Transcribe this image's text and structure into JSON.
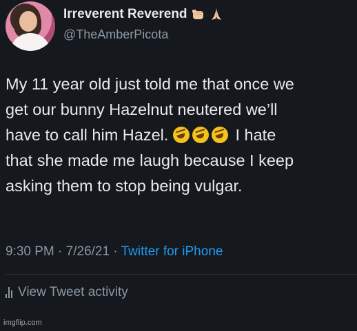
{
  "author": {
    "display_name": "Irreverent Reverend",
    "handle": "@TheAmberPicota",
    "name_emojis": [
      "fist-bump-emoji",
      "praying-hands-emoji"
    ]
  },
  "tweet": {
    "lines": [
      "My 11 year old just told me that once we",
      "get our bunny Hazelnut neutered we’ll",
      "have to call him Hazel.",
      "that she made me laugh because I keep",
      "asking them to stop being vulgar."
    ],
    "line3_after_emoji": "I hate",
    "emoji_count": 3
  },
  "meta": {
    "time": "9:30 PM",
    "date": "7/26/21",
    "separator": "·",
    "source": "Twitter for iPhone"
  },
  "actions": {
    "view_activity": "View Tweet activity"
  },
  "watermark": "imgflip.com",
  "colors": {
    "background": "#15181c",
    "text": "#e7e9ea",
    "muted": "#8b98a5",
    "link": "#1d9bf0"
  }
}
